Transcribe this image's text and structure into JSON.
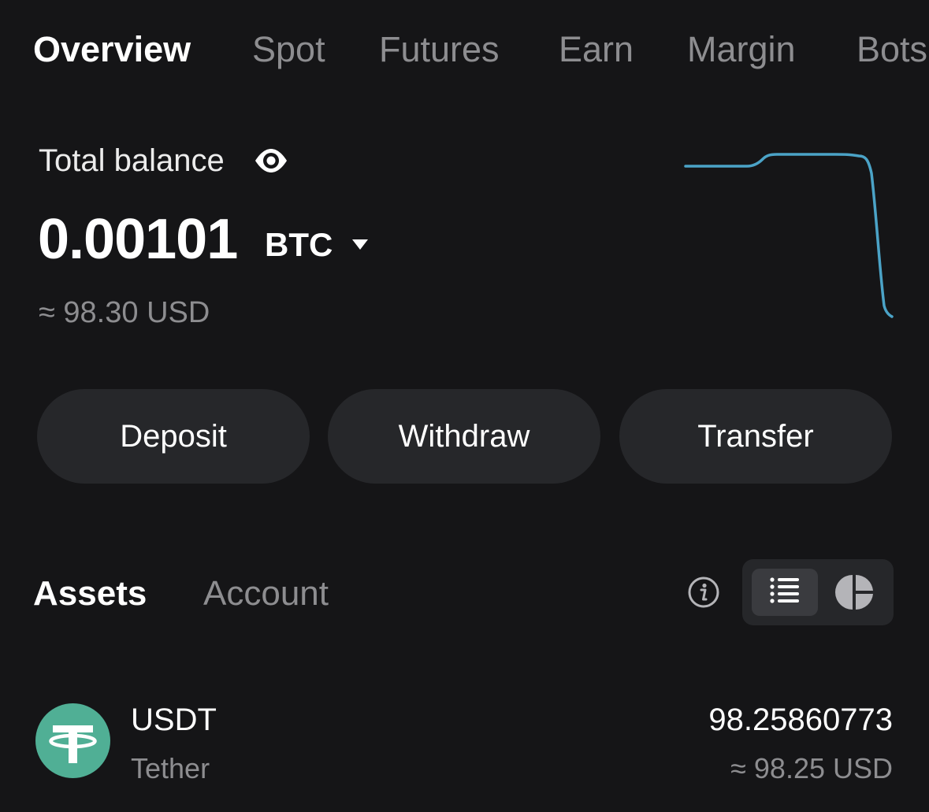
{
  "top_tabs": [
    {
      "label": "Overview",
      "active": true
    },
    {
      "label": "Spot",
      "active": false
    },
    {
      "label": "Futures",
      "active": false
    },
    {
      "label": "Earn",
      "active": false
    },
    {
      "label": "Margin",
      "active": false
    },
    {
      "label": "Bots",
      "active": false
    }
  ],
  "balance": {
    "label": "Total balance",
    "visibility_icon": "eye-icon",
    "amount": "0.00101",
    "currency": "BTC",
    "currency_dropdown_icon": "caret-down-icon",
    "approx_usd": "≈ 98.30 USD",
    "sparkline_color": "#4ba3c7"
  },
  "actions": {
    "deposit": "Deposit",
    "withdraw": "Withdraw",
    "transfer": "Transfer"
  },
  "section_tabs": [
    {
      "label": "Assets",
      "active": true
    },
    {
      "label": "Account",
      "active": false
    }
  ],
  "view_controls": {
    "info_icon": "info-icon",
    "list_icon": "list-icon",
    "pie_icon": "pie-chart-icon",
    "selected": "list"
  },
  "assets": [
    {
      "symbol": "USDT",
      "name": "Tether",
      "balance": "98.25860773",
      "approx_usd": "≈ 98.25 USD",
      "icon": "tether-icon",
      "icon_color": "#50af95"
    }
  ],
  "colors": {
    "background": "#151517",
    "button": "#26272a",
    "muted_text": "#8d8d90",
    "accent_line": "#4ba3c7"
  }
}
